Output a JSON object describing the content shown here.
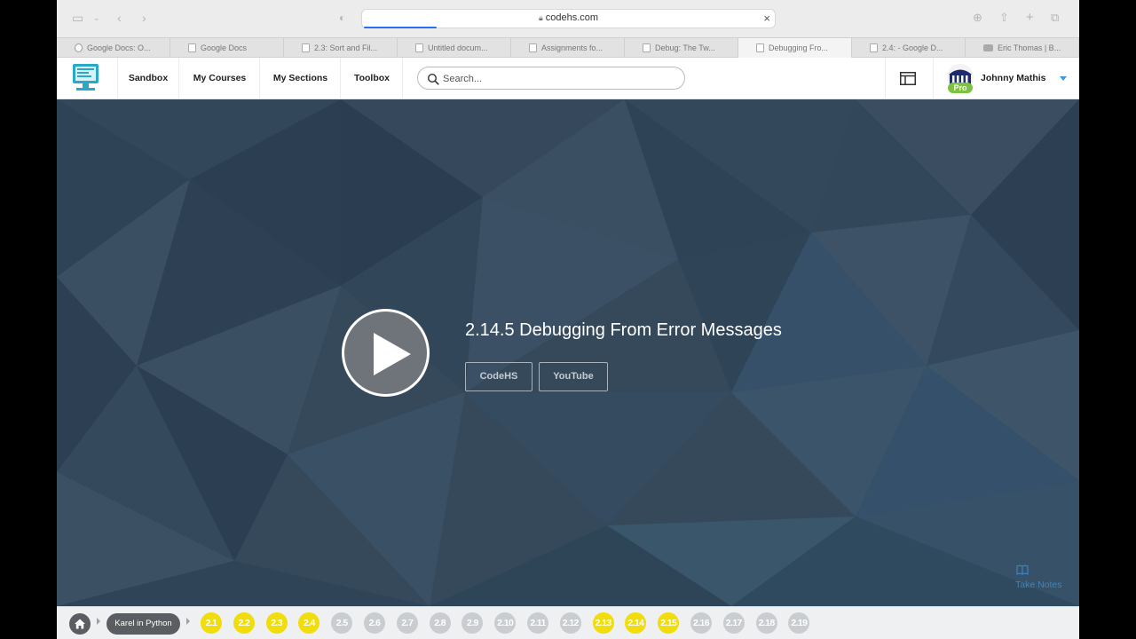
{
  "browser": {
    "url": "codehs.com",
    "tabs": [
      {
        "label": "Google Docs: O...",
        "favicon": "google-icon"
      },
      {
        "label": "Google Docs",
        "favicon": "doc-icon"
      },
      {
        "label": "2.3: Sort and Fil...",
        "favicon": "doc-icon"
      },
      {
        "label": "Untitled docum...",
        "favicon": "doc-icon"
      },
      {
        "label": "Assignments fo...",
        "favicon": "page-icon"
      },
      {
        "label": "Debug: The Tw...",
        "favicon": "page-icon"
      },
      {
        "label": "Debugging Fro...",
        "favicon": "page-icon",
        "active": true
      },
      {
        "label": "2.4: - Google D...",
        "favicon": "doc-icon"
      },
      {
        "label": "Eric Thomas | B...",
        "favicon": "youtube-icon"
      }
    ]
  },
  "nav": {
    "links": {
      "sandbox": "Sandbox",
      "courses": "My Courses",
      "sections": "My Sections",
      "toolbox": "Toolbox"
    },
    "search_placeholder": "Search...",
    "user": {
      "name": "Johnny Mathis",
      "badge": "Pro"
    }
  },
  "video": {
    "title": "2.14.5 Debugging From Error Messages",
    "sources": [
      "CodeHS",
      "YouTube"
    ],
    "take_notes": "Take Notes"
  },
  "course": {
    "name": "Karel in Python",
    "lessons": [
      {
        "label": "2.1",
        "done": true
      },
      {
        "label": "2.2",
        "done": true
      },
      {
        "label": "2.3",
        "done": true
      },
      {
        "label": "2.4",
        "done": true
      },
      {
        "label": "2.5",
        "done": false
      },
      {
        "label": "2.6",
        "done": false
      },
      {
        "label": "2.7",
        "done": false
      },
      {
        "label": "2.8",
        "done": false
      },
      {
        "label": "2.9",
        "done": false
      },
      {
        "label": "2.10",
        "done": false
      },
      {
        "label": "2.11",
        "done": false
      },
      {
        "label": "2.12",
        "done": false
      },
      {
        "label": "2.13",
        "done": true
      },
      {
        "label": "2.14",
        "done": true
      },
      {
        "label": "2.15",
        "done": true
      },
      {
        "label": "2.16",
        "done": false
      },
      {
        "label": "2.17",
        "done": false
      },
      {
        "label": "2.18",
        "done": false
      },
      {
        "label": "2.19",
        "done": false
      }
    ]
  },
  "colors": {
    "lesson_done": "#f2dd0c",
    "lesson_todo": "#c9cdd1",
    "hero_bg": "#354a5d",
    "pro_badge": "#7dc242"
  }
}
